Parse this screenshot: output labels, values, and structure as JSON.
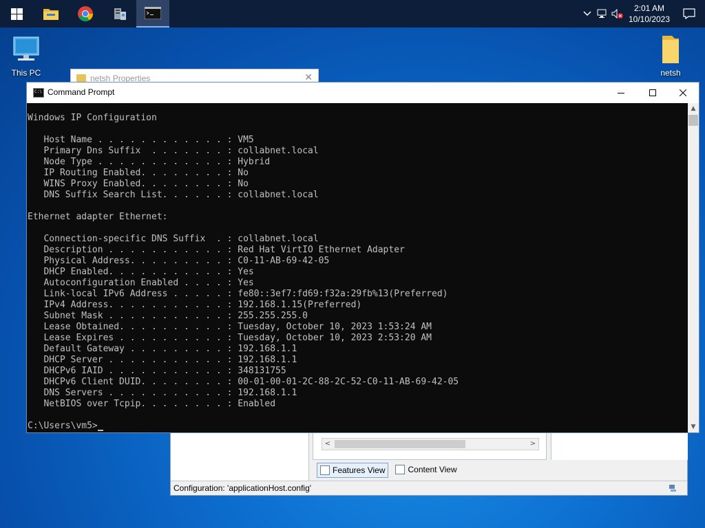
{
  "taskbar": {
    "apps": [
      {
        "name": "start",
        "icon": "windows-logo-icon"
      },
      {
        "name": "file-explorer",
        "icon": "folder-icon"
      },
      {
        "name": "chrome",
        "icon": "chrome-icon"
      },
      {
        "name": "server-manager",
        "icon": "server-manager-icon"
      },
      {
        "name": "command-prompt",
        "icon": "cmd-icon",
        "active": true
      }
    ],
    "clock": {
      "time": "2:01 AM",
      "date": "10/10/2023"
    }
  },
  "desktop": {
    "icons": [
      {
        "label": "This PC"
      },
      {
        "label": "netsh"
      }
    ]
  },
  "background_windows": {
    "netsh_properties": {
      "title": "netsh Properties"
    },
    "iis_manager": {
      "tabs": [
        {
          "label": "Features View",
          "selected": true
        },
        {
          "label": "Content View",
          "selected": false
        }
      ],
      "status": "Configuration: 'applicationHost.config'"
    }
  },
  "cmd_window": {
    "title": "Command Prompt",
    "lines": [
      "Windows IP Configuration",
      "",
      "   Host Name . . . . . . . . . . . . : VM5",
      "   Primary Dns Suffix  . . . . . . . : collabnet.local",
      "   Node Type . . . . . . . . . . . . : Hybrid",
      "   IP Routing Enabled. . . . . . . . : No",
      "   WINS Proxy Enabled. . . . . . . . : No",
      "   DNS Suffix Search List. . . . . . : collabnet.local",
      "",
      "Ethernet adapter Ethernet:",
      "",
      "   Connection-specific DNS Suffix  . : collabnet.local",
      "   Description . . . . . . . . . . . : Red Hat VirtIO Ethernet Adapter",
      "   Physical Address. . . . . . . . . : C0-11-AB-69-42-05",
      "   DHCP Enabled. . . . . . . . . . . : Yes",
      "   Autoconfiguration Enabled . . . . : Yes",
      "   Link-local IPv6 Address . . . . . : fe80::3ef7:fd69:f32a:29fb%13(Preferred)",
      "   IPv4 Address. . . . . . . . . . . : 192.168.1.15(Preferred)",
      "   Subnet Mask . . . . . . . . . . . : 255.255.255.0",
      "   Lease Obtained. . . . . . . . . . : Tuesday, October 10, 2023 1:53:24 AM",
      "   Lease Expires . . . . . . . . . . : Tuesday, October 10, 2023 2:53:20 AM",
      "   Default Gateway . . . . . . . . . : 192.168.1.1",
      "   DHCP Server . . . . . . . . . . . : 192.168.1.1",
      "   DHCPv6 IAID . . . . . . . . . . . : 348131755",
      "   DHCPv6 Client DUID. . . . . . . . : 00-01-00-01-2C-88-2C-52-C0-11-AB-69-42-05",
      "   DNS Servers . . . . . . . . . . . : 192.168.1.1",
      "   NetBIOS over Tcpip. . . . . . . . : Enabled",
      ""
    ],
    "prompt": "C:\\Users\\vm5>"
  }
}
